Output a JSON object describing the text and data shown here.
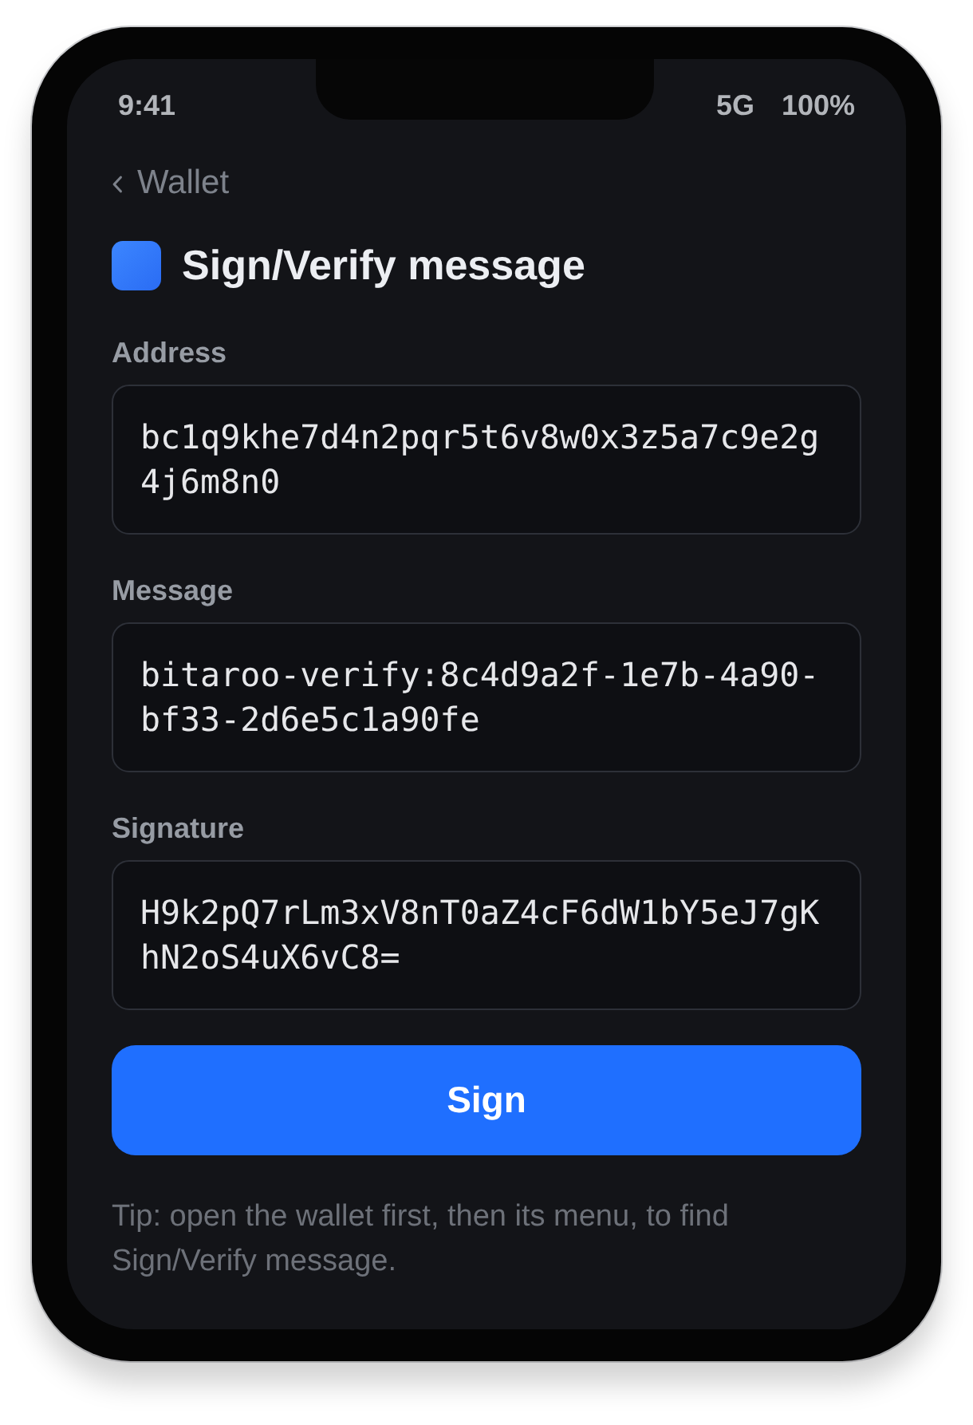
{
  "status_bar": {
    "time": "9:41",
    "network": "5G",
    "battery": "100%"
  },
  "back_link": {
    "label": "Wallet"
  },
  "title": "Sign/Verify message",
  "fields": [
    {
      "label": "Address",
      "value": "bc1q9khe7d4n2pqr5t6v8w0x3z5a7c9e2g4j6m8n0"
    },
    {
      "label": "Message",
      "value": "bitaroo-verify:8c4d9a2f-1e7b-4a90-bf33-2d6e5c1a90fe"
    },
    {
      "label": "Signature",
      "value": "H9k2pQ7rLm3xV8nT0aZ4cF6dW1bY5eJ7gKhN2oS4uX6vC8="
    }
  ],
  "primary_button": {
    "label": "Sign"
  },
  "tip": "Tip: open the wallet first, then its menu, to find Sign/Verify message."
}
